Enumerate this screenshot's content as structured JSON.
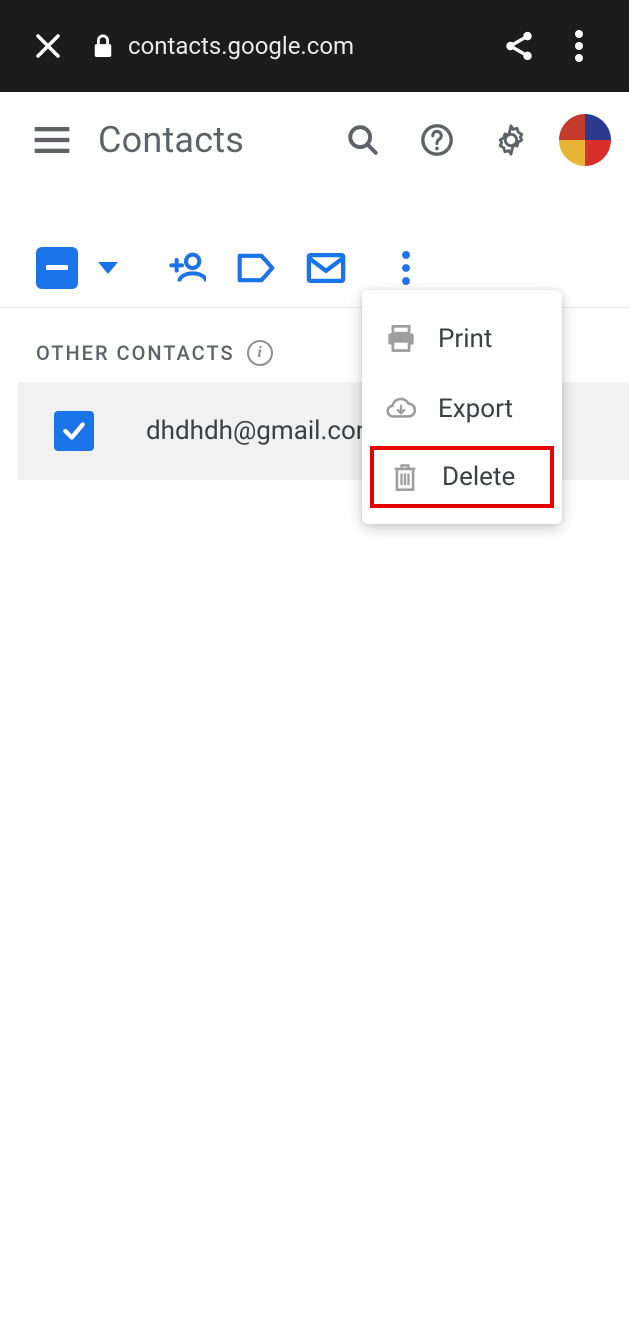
{
  "browser": {
    "url": "contacts.google.com"
  },
  "header": {
    "title": "Contacts"
  },
  "section": {
    "label": "OTHER CONTACTS"
  },
  "contacts": [
    {
      "email": "dhdhdh@gmail.com"
    }
  ],
  "popup": {
    "items": [
      {
        "label": "Print"
      },
      {
        "label": "Export"
      },
      {
        "label": "Delete"
      }
    ]
  },
  "colors": {
    "accent": "#1a73e8",
    "highlight": "#e60000"
  }
}
